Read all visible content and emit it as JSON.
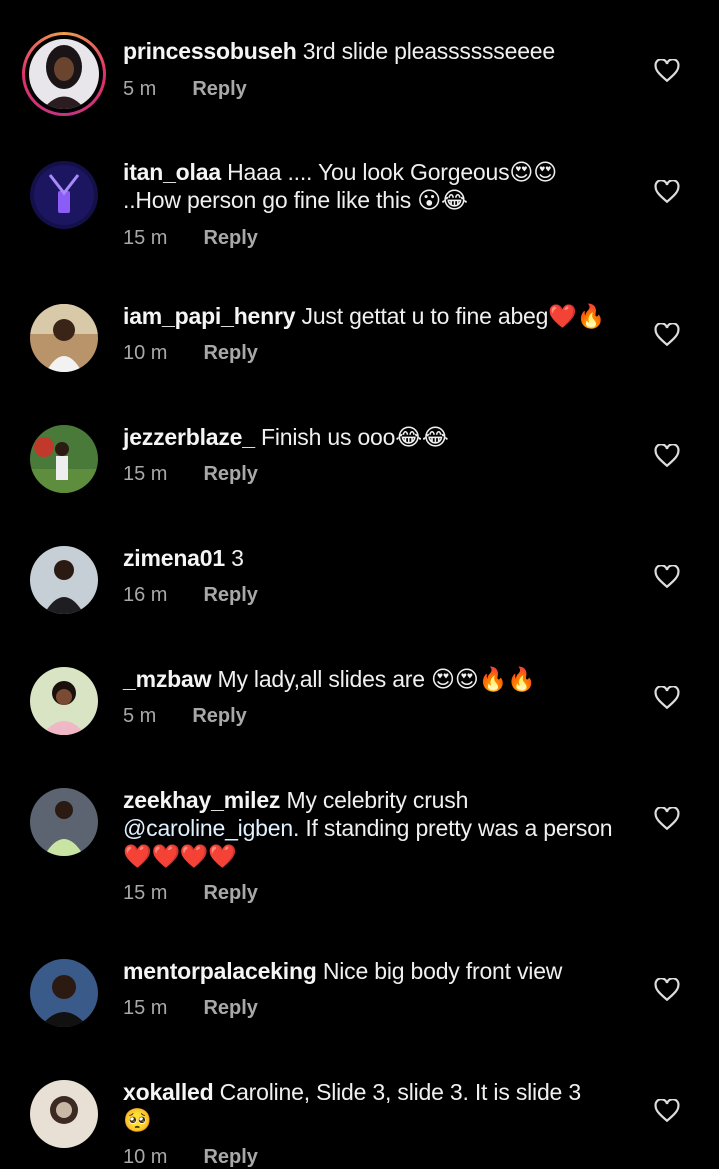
{
  "comments": [
    {
      "username": "princessobuseh",
      "text": "3rd slide pleasssssseeee",
      "time": "5 m",
      "reply": "Reply"
    },
    {
      "username": "itan_olaa",
      "text": "Haaa .... You look Gorgeous😍😍 ..How person go fine like this 😮😂",
      "time": "15 m",
      "reply": "Reply"
    },
    {
      "username": "iam_papi_henry",
      "text": "Just gettat u to fine abeg❤️🔥",
      "time": "10 m",
      "reply": "Reply"
    },
    {
      "username": "jezzerblaze_",
      "text": "Finish us ooo😂😂",
      "time": "15 m",
      "reply": "Reply"
    },
    {
      "username": "zimena01",
      "text": "3",
      "time": "16 m",
      "reply": "Reply"
    },
    {
      "username": "_mzbaw",
      "text": "My lady,all slides are 😍😍🔥🔥",
      "time": "5 m",
      "reply": "Reply"
    },
    {
      "username": "zeekhay_milez",
      "text_pre": "My celebrity crush",
      "mention": "@caroline_igben",
      "text_post": ".  If standing pretty was a person ❤️❤️❤️❤️",
      "time": "15 m",
      "reply": "Reply"
    },
    {
      "username": "mentorpalaceking",
      "text": "Nice big body front view",
      "time": "15 m",
      "reply": "Reply"
    },
    {
      "username": "xokalled",
      "text": "Caroline, Slide 3, slide 3. It is slide 3 🥺",
      "time": "10 m",
      "reply": "Reply"
    }
  ],
  "colors": {
    "background": "#000000",
    "text": "#ffffff",
    "meta": "#a8a8a8",
    "ring": "#e1306c"
  },
  "icons": {
    "like": "heart-outline-icon"
  }
}
